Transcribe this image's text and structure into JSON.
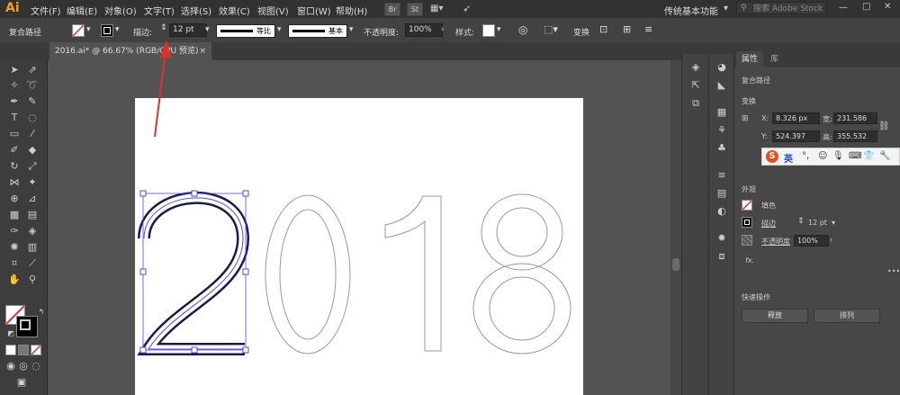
{
  "app": {
    "logo": "Ai",
    "workspace": "传统基本功能",
    "stock_search_placeholder": "搜索 Adobe Stock"
  },
  "menu": [
    "文件(F)",
    "编辑(E)",
    "对象(O)",
    "文字(T)",
    "选择(S)",
    "效果(C)",
    "视图(V)",
    "窗口(W)",
    "帮助(H)"
  ],
  "menu_buttons": [
    "Br",
    "St"
  ],
  "control": {
    "object_type": "复合路径",
    "stroke_label": "描边:",
    "stroke_value": "12 pt",
    "profile_label": "等比",
    "brush_label": "基本",
    "opacity_label": "不透明度:",
    "opacity_value": "100%",
    "style_label": "样式:",
    "transform_label": "变换"
  },
  "document_tab": {
    "title": "2016.ai* @ 66.67% (RGB/GPU 预览)",
    "close": "×"
  },
  "artwork": {
    "text": "2018",
    "selected_char": "2"
  },
  "panel": {
    "tabs": [
      "属性",
      "库"
    ],
    "object_type": "复合路径",
    "transform_title": "变换",
    "x_label": "X:",
    "x_value": "8.326 px",
    "w_label": "宽:",
    "w_value": "231.586",
    "y_label": "Y:",
    "y_value": "524.397",
    "h_label": "高:",
    "h_value": "355.532",
    "appearance_title": "外观",
    "fill_label": "填色",
    "stroke_label": "描边",
    "stroke_value": "12 pt",
    "opacity_label": "不透明度",
    "opacity_value": "100%",
    "fx_label": "fx.",
    "quick_actions_title": "快速操作",
    "release_button": "释放",
    "arrange_button": "排列"
  },
  "ime": {
    "logo": "S",
    "lang": "英"
  },
  "colors": {
    "accent_orange": "#f59a23",
    "selection_blue": "#4a4aff",
    "annotation_red": "#e0302a",
    "ime_red": "#e84d1c"
  }
}
